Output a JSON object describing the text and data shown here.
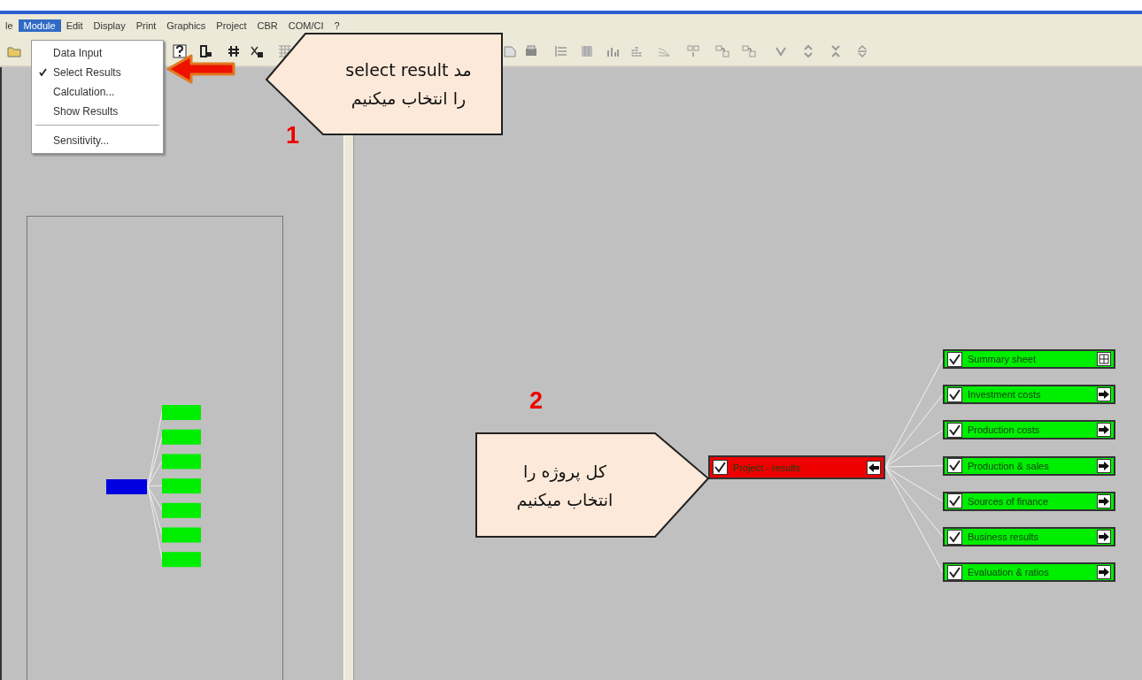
{
  "menu_bar": {
    "items": [
      {
        "label": "le",
        "selected": false
      },
      {
        "label": "Module",
        "selected": true
      },
      {
        "label": "Edit",
        "selected": false
      },
      {
        "label": "Display",
        "selected": false
      },
      {
        "label": "Print",
        "selected": false
      },
      {
        "label": "Graphics",
        "selected": false
      },
      {
        "label": "Project",
        "selected": false
      },
      {
        "label": "CBR",
        "selected": false
      },
      {
        "label": "COM/CI",
        "selected": false
      },
      {
        "label": "?",
        "selected": false
      }
    ]
  },
  "module_menu": {
    "groups": [
      [
        {
          "label": "Data Input",
          "checked": false
        },
        {
          "label": "Select Results",
          "checked": true
        },
        {
          "label": "Calculation...",
          "checked": false
        },
        {
          "label": "Show Results",
          "checked": false
        }
      ],
      [
        {
          "label": "Sensitivity...",
          "checked": false
        }
      ]
    ]
  },
  "result_tree": {
    "root": {
      "label": "Project - results",
      "checked": true,
      "color": "#ee0000",
      "kind": "root"
    },
    "children": [
      {
        "label": "Summary sheet",
        "checked": true,
        "color": "#00ee00",
        "kind": "summary"
      },
      {
        "label": "Investment costs",
        "checked": true,
        "color": "#00ee00",
        "kind": "report"
      },
      {
        "label": "Production costs",
        "checked": true,
        "color": "#00ee00",
        "kind": "report"
      },
      {
        "label": "Production & sales",
        "checked": true,
        "color": "#00ee00",
        "kind": "report"
      },
      {
        "label": "Sources of finance",
        "checked": true,
        "color": "#00ee00",
        "kind": "report"
      },
      {
        "label": "Business results",
        "checked": true,
        "color": "#00ee00",
        "kind": "report"
      },
      {
        "label": "Evaluation & ratios",
        "checked": true,
        "color": "#00ee00",
        "kind": "report"
      }
    ]
  },
  "callouts": [
    {
      "step": "1",
      "lines": [
        "مد select result",
        "را انتخاب میکنیم"
      ]
    },
    {
      "step": "2",
      "lines": [
        "کل پروژه را",
        "انتخاب میکنیم"
      ]
    }
  ]
}
